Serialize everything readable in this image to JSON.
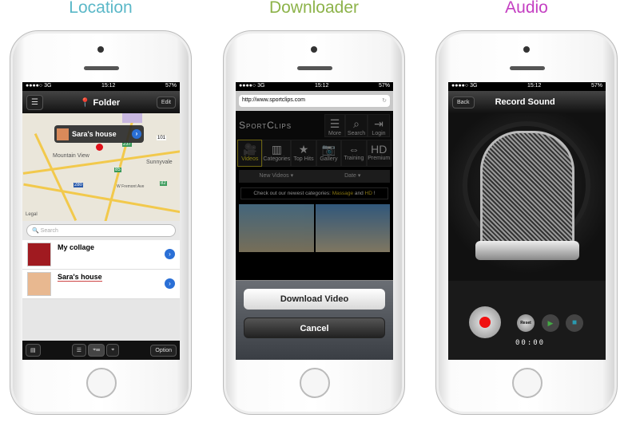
{
  "titles": {
    "location": "Location",
    "downloader": "Downloader",
    "audio": "Audio"
  },
  "colors": {
    "location": "#5bb8c8",
    "downloader": "#8db34a",
    "audio": "#c43fc2"
  },
  "status": {
    "carrier": "●●●●○ 3G",
    "time": "15:12",
    "battery": "57%"
  },
  "location": {
    "nav_title": "Folder",
    "edit": "Edit",
    "callout": "Sara's house",
    "map_labels": [
      "Mountain View",
      "Sunnyvale",
      "101",
      "85",
      "237",
      "280",
      "82",
      "W Fremont Ave",
      "Legal"
    ],
    "search_placeholder": "Search",
    "items": [
      {
        "label": "My collage"
      },
      {
        "label": "Sara's house"
      }
    ],
    "option": "Option"
  },
  "downloader": {
    "url": "http://www.sportclips.com",
    "brand": "SportClips",
    "top_buttons": [
      "More",
      "Search",
      "Login"
    ],
    "tabs": [
      "Videos",
      "Categories",
      "Top Hits",
      "Gallery",
      "Training",
      "Premium"
    ],
    "sort": [
      "New Videos ▾",
      "Date ▾"
    ],
    "banner_prefix": "Check out our newest categories: ",
    "banner_a": "Massage",
    "banner_and": " and ",
    "banner_b": "HD",
    "banner_end": " !",
    "download": "Download Video",
    "cancel": "Cancel"
  },
  "audio": {
    "back": "Back",
    "nav_title": "Record Sound",
    "reset": "Reset",
    "timer": "00:00"
  }
}
